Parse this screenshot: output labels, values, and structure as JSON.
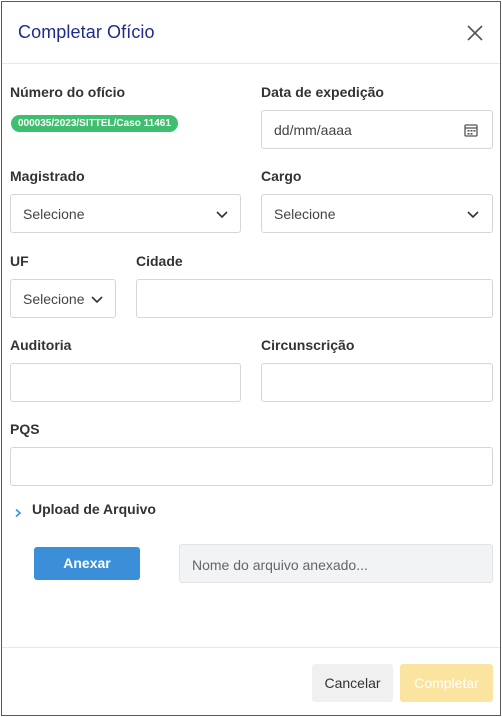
{
  "modal": {
    "title": "Completar Ofício",
    "close_icon": "close-icon"
  },
  "form": {
    "numero_oficio": {
      "label": "Número do ofício",
      "badge": "000035/2023/SITTEL/Caso 11461",
      "badge_color": "#3ebf6e"
    },
    "data_expedicao": {
      "label": "Data de expedição",
      "placeholder": "dd/mm/aaaa",
      "icon": "calendar-icon"
    },
    "magistrado": {
      "label": "Magistrado",
      "value": "Selecione"
    },
    "cargo": {
      "label": "Cargo",
      "value": "Selecione"
    },
    "uf": {
      "label": "UF",
      "value": "Selecione"
    },
    "cidade": {
      "label": "Cidade",
      "value": ""
    },
    "auditoria": {
      "label": "Auditoria",
      "value": ""
    },
    "circunscricao": {
      "label": "Circunscrição",
      "value": ""
    },
    "pqs": {
      "label": "PQS",
      "value": ""
    }
  },
  "upload": {
    "toggle_label": "Upload de Arquivo",
    "attach_button": "Anexar",
    "filename_placeholder": "Nome do arquivo anexado...",
    "accent": "#3a8fd8"
  },
  "footer": {
    "cancel_label": "Cancelar",
    "complete_label": "Completar",
    "complete_color": "#fbe3a0"
  }
}
